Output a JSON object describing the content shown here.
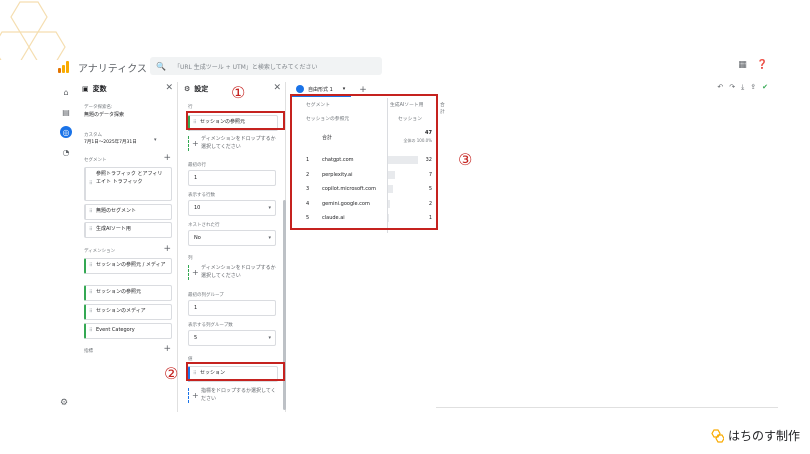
{
  "app": {
    "title": "アナリティクス",
    "search_placeholder": "「URL 生成ツール + UTM」と検索してみてください"
  },
  "colors": {
    "accent": "#1a73e8",
    "highlight_red": "#c5221f",
    "dimension_green": "#34a853",
    "brand_yellow": "#f9ab00"
  },
  "top_icons": [
    "apps-grid-icon",
    "help-icon"
  ],
  "nav_icons": [
    "home-icon",
    "reports-icon",
    "explore-icon",
    "advertising-icon",
    "admin-gear-icon"
  ],
  "variables_panel": {
    "title": "変数",
    "exploration_name_label": "データ探索名:",
    "exploration_name": "無題のデータ探索",
    "date_label": "カスタム",
    "date_range": "7月1日～2025年7月31日",
    "segments_label": "セグメント",
    "segments": [
      "参照トラフィック とアフィリエイト トラフィック",
      "無題のセグメント",
      "生成AIソート用"
    ],
    "dimensions_label": "ディメンション",
    "dimensions": [
      "セッションの参照元 / メディア",
      "セッションの参照元",
      "セッションのメディア",
      "Event Category"
    ],
    "metrics_label": "指標"
  },
  "settings_panel": {
    "title": "設定",
    "rows_label": "行",
    "row_item": "セッションの参照元",
    "drop_dimension": "ディメンションをドロップするか選択してください",
    "start_row_label": "最初の行",
    "start_row": "1",
    "show_rows_label": "表示する行数",
    "show_rows": "10",
    "nested_rows_label": "ネストされた行",
    "nested_rows": "No",
    "columns_label": "列",
    "start_col_group_label": "最初の列グループ",
    "start_col_group": "1",
    "show_col_groups_label": "表示する列グループ数",
    "show_col_groups": "5",
    "values_label": "値",
    "value_item": "セッション",
    "drop_metric": "指標をドロップするか選択してください"
  },
  "main": {
    "tab_label": "自由形式 1",
    "toolbar_icons": [
      "undo-icon",
      "redo-icon",
      "download-icon",
      "share-icon",
      "check-icon"
    ],
    "report": {
      "segment_header": "セグメント",
      "segment_value": "生成AIソート用",
      "total_column_label": "合計",
      "dim_header": "セッションの参照元",
      "metric_header": "セッション",
      "total_label": "合計",
      "total_value": "47",
      "total_pct": "全体の 100.0%",
      "rows": [
        {
          "idx": "1",
          "name": "chatgpt.com",
          "value": "32",
          "share": 0.68
        },
        {
          "idx": "2",
          "name": "perplexity.ai",
          "value": "7",
          "share": 0.15
        },
        {
          "idx": "3",
          "name": "copilot.microsoft.com",
          "value": "5",
          "share": 0.11
        },
        {
          "idx": "4",
          "name": "gemini.google.com",
          "value": "2",
          "share": 0.04
        },
        {
          "idx": "5",
          "name": "claude.ai",
          "value": "1",
          "share": 0.02
        }
      ]
    }
  },
  "annotations": {
    "one": "①",
    "two": "②",
    "three": "③"
  },
  "brand": {
    "name": "はちのす制作"
  }
}
